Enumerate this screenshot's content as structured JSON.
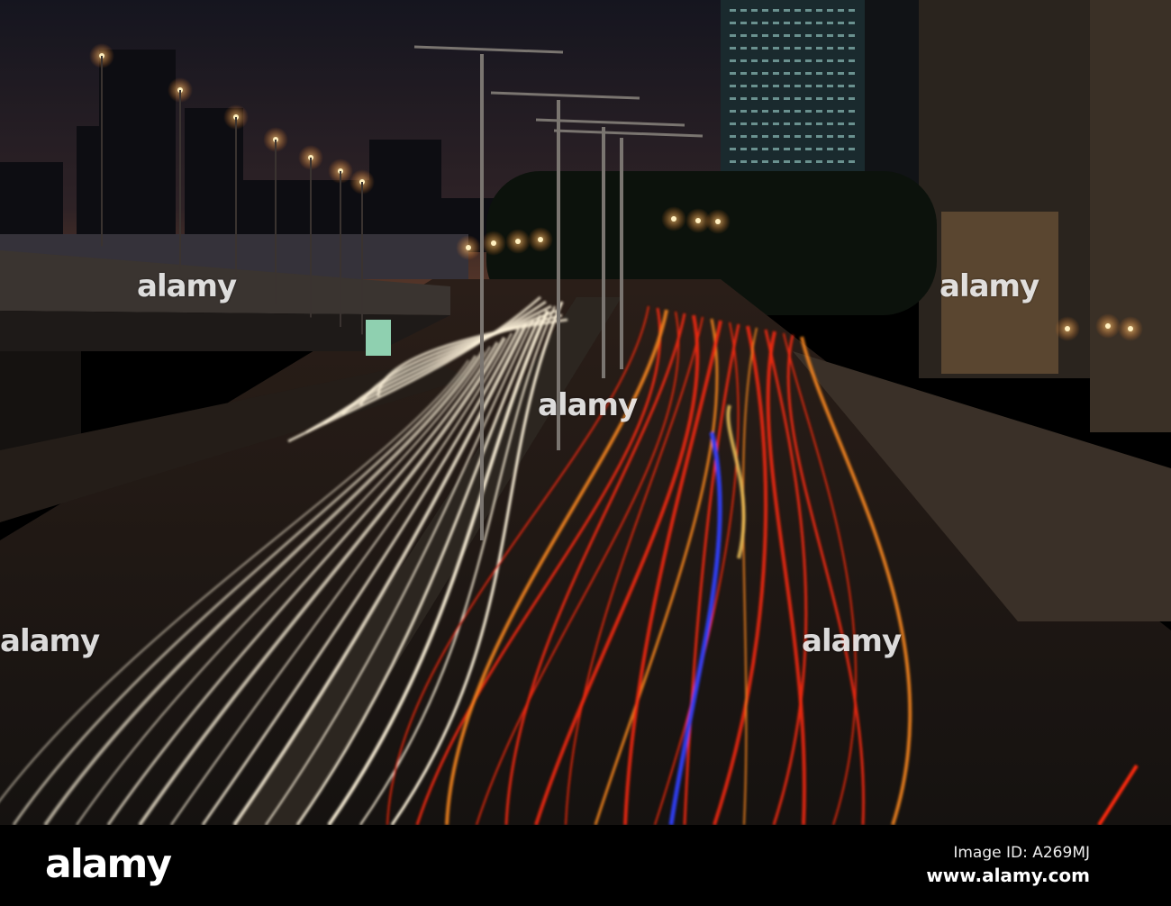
{
  "photo": {
    "subject": "Night traffic light trails",
    "watermark": "alamy",
    "colors": {
      "sky_top": "#14141e",
      "sky_horizon": "#4a2e26",
      "tail_light": "#ff2a10",
      "head_light": "#fff4dc",
      "street_lamp": "#ffb040",
      "blue_trail": "#3040ff"
    }
  },
  "footer": {
    "logo": "alamy",
    "image_id": "Image ID: A269MJ",
    "url": "www.alamy.com"
  }
}
